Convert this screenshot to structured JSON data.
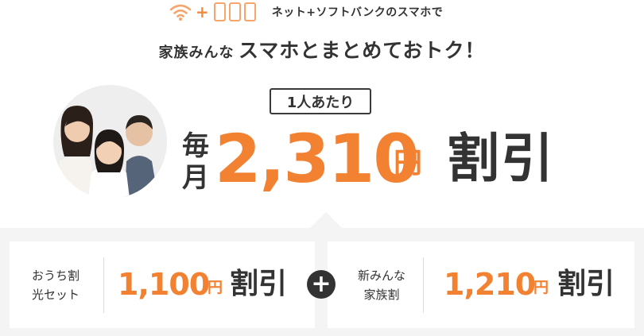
{
  "header": {
    "icons": [
      "wifi-icon",
      "plus",
      "smartphone-icon",
      "smartphone-icon",
      "smartphone-icon"
    ],
    "plus_symbol": "+",
    "tagline": "ネット+ソフトバンクのスマホで",
    "headline_small": "家族みんな",
    "headline_big": "スマホとまとめておトク！"
  },
  "hero": {
    "photo_alt": "family-photo",
    "per_person_label": "1人あたり",
    "monthly_label_1": "毎",
    "monthly_label_2": "月",
    "amount": "2,310",
    "yen": "円",
    "discount_label": "割引"
  },
  "breakdown": {
    "item1": {
      "label_line1": "おうち割",
      "label_line2": "光セット",
      "amount": "1,100",
      "yen": "円",
      "discount": "割引"
    },
    "plus_symbol": "+",
    "item2": {
      "label_line1": "新みんな",
      "label_line2": "家族割",
      "amount": "1,210",
      "yen": "円",
      "discount": "割引"
    }
  },
  "colors": {
    "accent": "#f38132",
    "icon_orange": "#f6a56c",
    "text": "#333333",
    "panel_bg": "#f4f4f4"
  }
}
